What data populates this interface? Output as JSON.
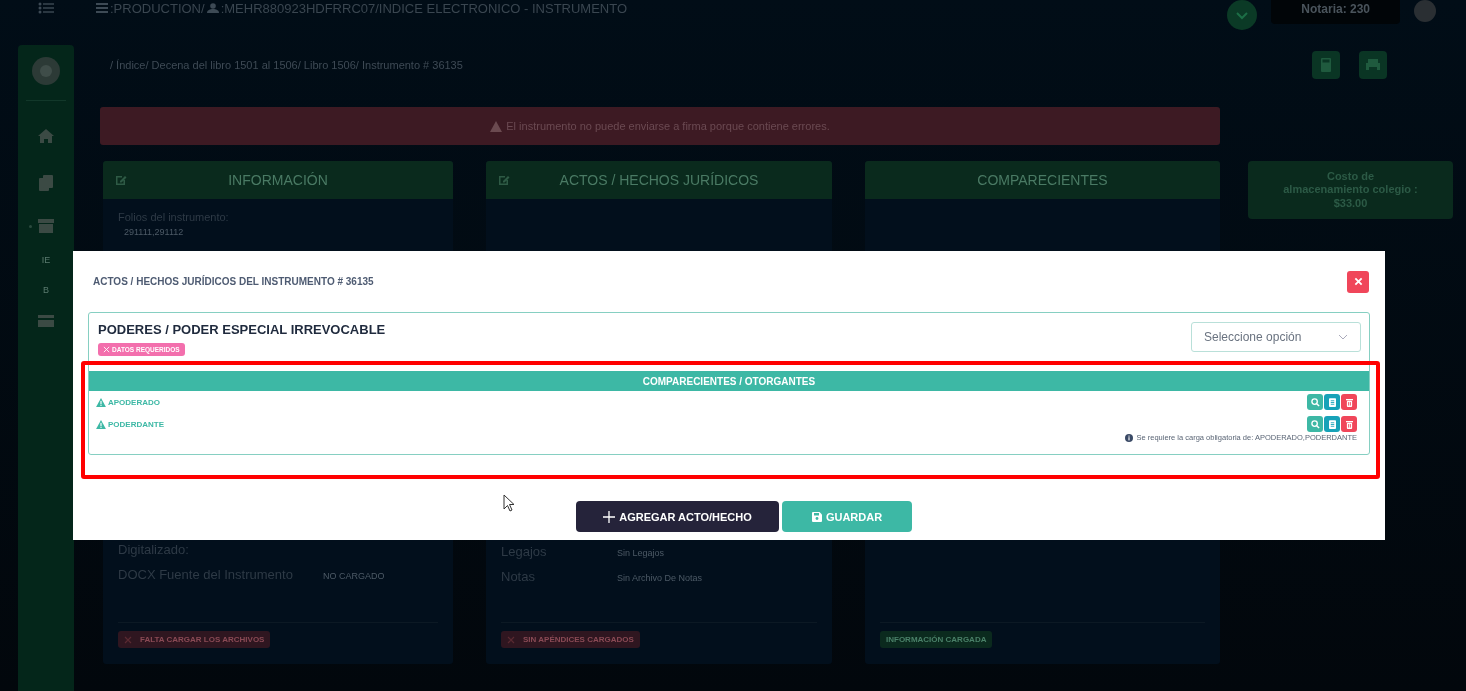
{
  "top_bar": {
    "segments": [
      ":PRODUCTION/",
      ":MEHR880923HDFRRC07/INDICE ELECTRONICO - INSTRUMENTO"
    ],
    "notaria": "Notaria: 230"
  },
  "sidebar": {
    "labels": [
      "IE",
      "B"
    ]
  },
  "breadcrumb": "/ Índice/ Decena del libro 1501 al 1506/ Libro 1506/ Instrumento # 36135",
  "alert": "El instrumento no puede enviarse a firma porque contiene errores.",
  "cards": [
    {
      "title": "INFORMACIÓN",
      "editable": true,
      "top_label": "Folios del instrumento:",
      "top_value": "291111,291112",
      "rows": [
        {
          "label": "Digitalizado:"
        },
        {
          "label": "DOCX Fuente del Instrumento",
          "value": "NO CARGADO"
        }
      ],
      "badge": {
        "text": "FALTA CARGAR LOS ARCHIVOS",
        "kind": "error"
      }
    },
    {
      "title": "ACTOS / HECHOS JURÍDICOS",
      "editable": true,
      "rows": [
        {
          "label": "Legajos",
          "value": "Sin Legajos"
        },
        {
          "label": "Notas",
          "value": "Sin Archivo De Notas"
        }
      ],
      "badge": {
        "text": "SIN APÉNDICES CARGADOS",
        "kind": "error"
      }
    },
    {
      "title": "COMPARECIENTES",
      "editable": false,
      "badge": {
        "text": "INFORMACIÓN CARGADA",
        "kind": "success"
      }
    }
  ],
  "cost_card": {
    "lines": [
      "Costo de",
      "almacenamiento colegio :",
      "$33.00"
    ]
  },
  "modal": {
    "title": "ACTOS / HECHOS JURÍDICOS DEL INSTRUMENTO # 36135",
    "act": {
      "title": "PODERES / PODER ESPECIAL IRREVOCABLE",
      "badge": "DATOS REQUERIDOS",
      "select": {
        "placeholder": "Seleccione opción"
      },
      "section_title": "COMPARECIENTES / OTORGANTES",
      "parties": [
        {
          "name": "APODERADO"
        },
        {
          "name": "PODERDANTE"
        }
      ],
      "note": "Se requiere la carga obligatoria de: APODERADO,PODERDANTE"
    },
    "buttons": [
      {
        "label": "AGREGAR ACTO/HECHO",
        "kind": "add"
      },
      {
        "label": "GUARDAR",
        "kind": "save"
      }
    ]
  }
}
